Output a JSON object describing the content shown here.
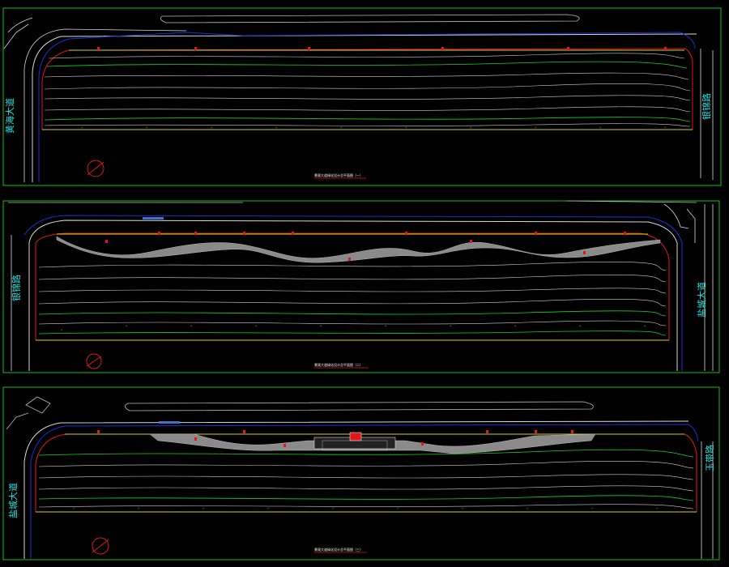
{
  "colors": {
    "background": "#000000",
    "frame": "#19c119",
    "road_edge": "#d9d9d9",
    "road_outline_blue": "#1b2fd6",
    "red_boundary": "#e01818",
    "yellow_line": "#d8d020",
    "green_line": "#1ed21e",
    "contour": "#cfcfcf",
    "path_fill": "#8a8a8a",
    "road_label": "#1ee6e6",
    "highlight": "#4a6fbf"
  },
  "panels": [
    {
      "road_labels": {
        "left": "黄海大道",
        "right": "银锦路"
      },
      "title": "景观大道绿化设计总平面图（一）"
    },
    {
      "road_labels": {
        "left": "银锦路",
        "right": "盐城大道"
      },
      "title": "景观大道绿化设计总平面图（二）"
    },
    {
      "road_labels": {
        "left": "盐城大道",
        "right": "玉带路"
      },
      "title": "景观大道绿化设计总平面图（三）"
    }
  ]
}
